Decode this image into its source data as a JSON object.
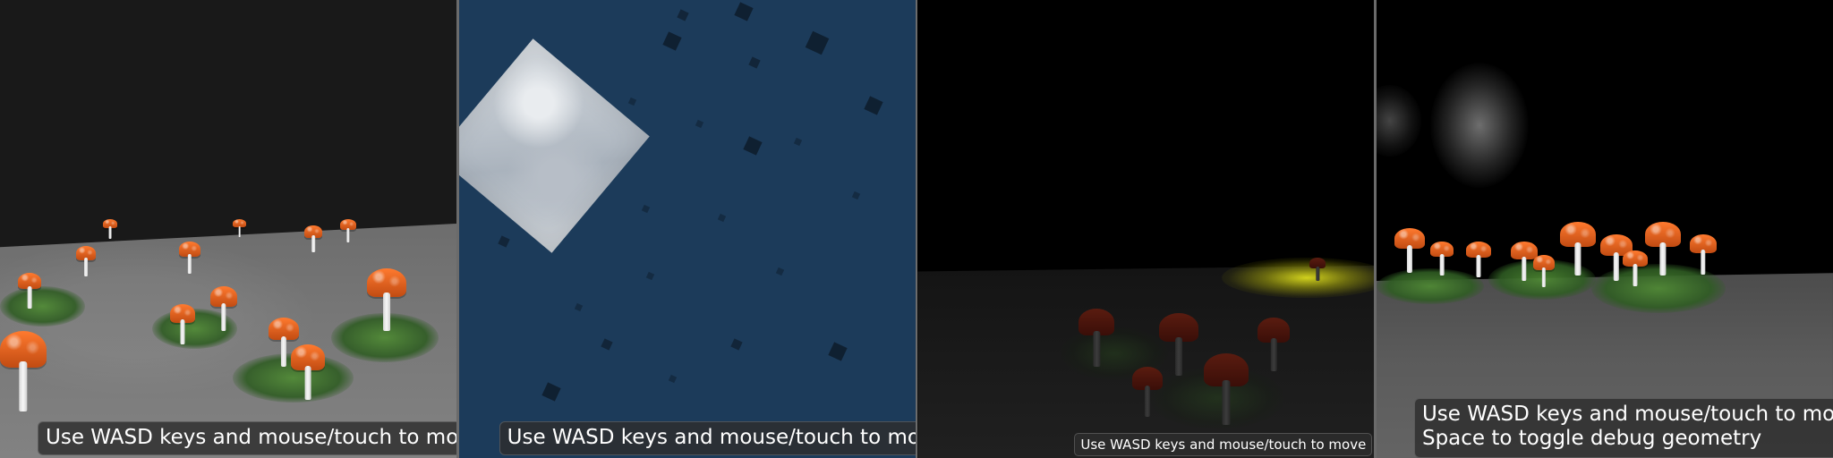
{
  "panels": {
    "p1": {
      "hud": {
        "line1": "Use WASD keys and mouse/touch to move"
      }
    },
    "p2": {
      "hud": {
        "line1": "Use WASD keys and mouse/touch to move"
      }
    },
    "p3": {
      "hud": {
        "line1": "Use WASD keys and mouse/touch to move"
      }
    },
    "p4": {
      "hud": {
        "line1": "Use WASD keys and mouse/touch to move",
        "line2": "Space to toggle debug geometry"
      }
    }
  },
  "colors": {
    "p1_sky": "#191919",
    "p2_background": "#1c3b5a",
    "spotlight": "#e6e61e",
    "mushroom_cap": "#ff7a2f",
    "hud_bg": "#2d2d2d"
  },
  "icons": {
    "mushrooms": "mushroom-icon",
    "cubes": "cube-icon",
    "smoke": "smoke-icon"
  }
}
